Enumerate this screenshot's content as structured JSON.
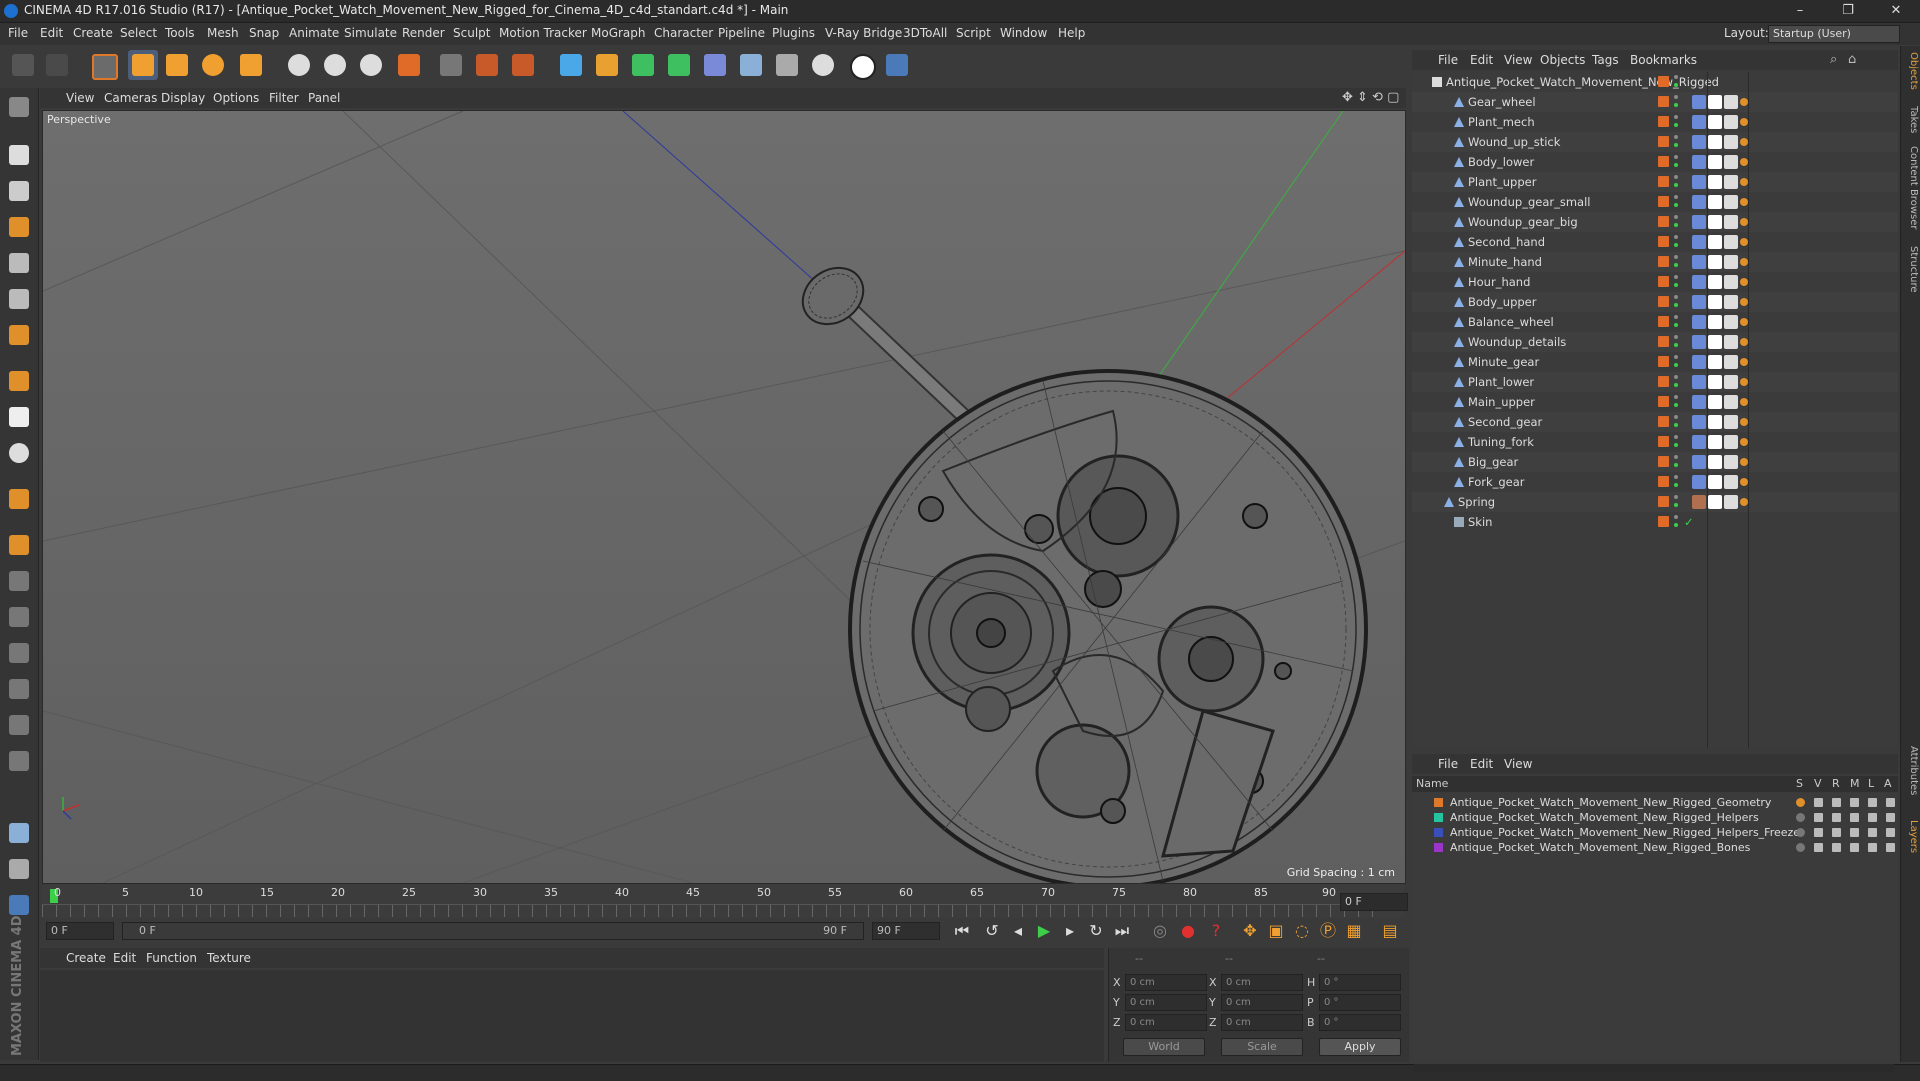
{
  "window": {
    "title": "CINEMA 4D R17.016 Studio (R17) - [Antique_Pocket_Watch_Movement_New_Rigged_for_Cinema_4D_c4d_standart.c4d *] - Main",
    "controls": [
      "–",
      "❐",
      "✕"
    ]
  },
  "menubar": {
    "items": [
      "File",
      "Edit",
      "Create",
      "Select",
      "Tools",
      "Mesh",
      "Snap",
      "Animate",
      "Simulate",
      "Render",
      "Sculpt",
      "Motion Tracker",
      "MoGraph",
      "Character",
      "Pipeline",
      "Plugins",
      "V-Ray Bridge",
      "3DToAll",
      "Script",
      "Window",
      "Help"
    ],
    "layout_label": "Layout:",
    "layout_value": "Startup (User)"
  },
  "viewport": {
    "menu": [
      "View",
      "Cameras",
      "Display",
      "Options",
      "Filter",
      "Panel"
    ],
    "camera_label": "Perspective",
    "grid_spacing": "Grid Spacing : 1 cm"
  },
  "timeline": {
    "ticks": [
      "0",
      "5",
      "10",
      "15",
      "20",
      "25",
      "30",
      "35",
      "40",
      "45",
      "50",
      "55",
      "60",
      "65",
      "70",
      "75",
      "80",
      "85",
      "90"
    ],
    "current_frame": "0 F",
    "start_field": "0 F",
    "range_start": "0 F",
    "range_end": "90 F",
    "end_field": "90 F"
  },
  "material_manager": {
    "menu": [
      "Create",
      "Edit",
      "Function",
      "Texture"
    ]
  },
  "coordinates": {
    "rows": [
      {
        "a": "X",
        "av": "0 cm",
        "b": "X",
        "bv": "0 cm",
        "c": "H",
        "cv": "0 °"
      },
      {
        "a": "Y",
        "av": "0 cm",
        "b": "Y",
        "bv": "0 cm",
        "c": "P",
        "cv": "0 °"
      },
      {
        "a": "Z",
        "av": "0 cm",
        "b": "Z",
        "bv": "0 cm",
        "c": "B",
        "cv": "0 °"
      }
    ],
    "header_left": "--",
    "header_mid": "--",
    "header_right": "--",
    "world": "World",
    "scale": "Scale",
    "apply": "Apply"
  },
  "object_manager": {
    "menu": [
      "File",
      "Edit",
      "View",
      "Objects",
      "Tags",
      "Bookmarks"
    ],
    "root": "Antique_Pocket_Watch_Movement_New_Rigged",
    "objects": [
      "Gear_wheel",
      "Plant_mech",
      "Wound_up_stick",
      "Body_lower",
      "Plant_upper",
      "Woundup_gear_small",
      "Woundup_gear_big",
      "Second_hand",
      "Minute_hand",
      "Hour_hand",
      "Body_upper",
      "Balance_wheel",
      "Woundup_details",
      "Minute_gear",
      "Plant_lower",
      "Main_upper",
      "Second_gear",
      "Tuning_fork",
      "Big_gear",
      "Fork_gear"
    ],
    "spring": "Spring",
    "skin": "Skin",
    "tag_color": "#e06a27"
  },
  "layers": {
    "menu": [
      "File",
      "Edit",
      "View"
    ],
    "headers": {
      "name": "Name",
      "s": "S",
      "v": "V",
      "r": "R",
      "m": "M",
      "l": "L",
      "a": "A"
    },
    "rows": [
      {
        "name": "Antique_Pocket_Watch_Movement_New_Rigged_Geometry",
        "color": "#e0782a"
      },
      {
        "name": "Antique_Pocket_Watch_Movement_New_Rigged_Helpers",
        "color": "#25c4a0"
      },
      {
        "name": "Antique_Pocket_Watch_Movement_New_Rigged_Helpers_Freeze",
        "color": "#3a4fb8"
      },
      {
        "name": "Antique_Pocket_Watch_Movement_New_Rigged_Bones",
        "color": "#9a35c8"
      }
    ]
  },
  "right_tabs": [
    "Objects",
    "Takes",
    "Content Browser",
    "Structure",
    "Attributes",
    "Layers"
  ],
  "brand": "MAXON CINEMA 4D"
}
